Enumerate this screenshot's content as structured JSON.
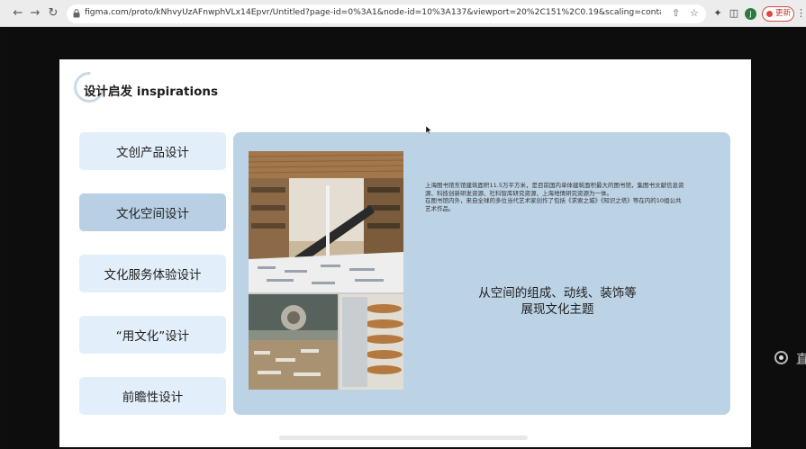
{
  "browser": {
    "back_icon": "arrow-left-icon",
    "forward_icon": "arrow-right-icon",
    "reload_icon": "reload-icon",
    "url": "figma.com/proto/kNhvyUzAFnwphVLx14Epvr/Untitled?page-id=0%3A1&node-id=10%3A137&viewport=20%2C151%2C0.19&scaling=contain&starting-point-...",
    "avatar_letter": "J",
    "update_label": "更新",
    "accent": "#d6483f"
  },
  "slide": {
    "title": "设计启发 inspirations",
    "menu": [
      {
        "label": "文创产品设计",
        "active": false
      },
      {
        "label": "文化空间设计",
        "active": true
      },
      {
        "label": "文化服务体验设计",
        "active": false
      },
      {
        "label": "“用文化”设计",
        "active": false
      },
      {
        "label": "前瞻性设计",
        "active": false
      }
    ],
    "description": [
      "上海图书馆东馆建筑面积11.5万平方米，是目前国内单体建筑面积最大的图书馆，集图书文献信息资源、科技创新研发资源、社科智库研究资源、上海地情研究资源为一体。",
      "在图书馆内外，来自全球的多位当代艺术家创作了包括《求索之城》《知识之塔》等在内的10组公共艺术作品。"
    ],
    "summary_line1": "从空间的组成、动线、装饰等",
    "summary_line2": "展现文化主题",
    "panel_color": "#bcd2e5",
    "menu_color": "#e2eef9",
    "menu_active_color": "#b9d0e4"
  },
  "side": {
    "text": "直"
  }
}
